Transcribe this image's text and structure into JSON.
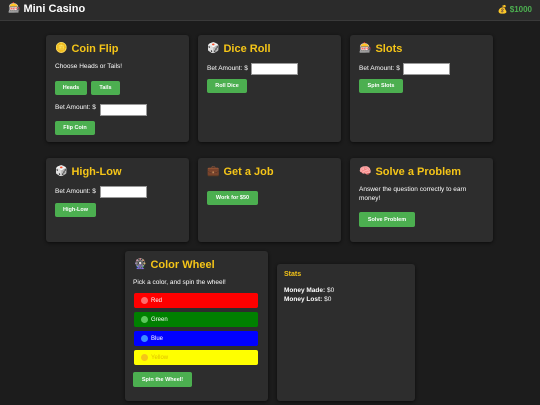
{
  "header": {
    "title": "Mini Casino",
    "balance": "$1000",
    "logo_icon": "slot-machine-icon",
    "money_icon": "money-bag-icon"
  },
  "coin_flip": {
    "title": "Coin Flip",
    "icon": "coin-icon",
    "prompt": "Choose Heads or Tails!",
    "heads_label": "Heads",
    "tails_label": "Tails",
    "bet_label": "Bet Amount: $",
    "bet_value": "",
    "action_label": "Flip Coin"
  },
  "dice_roll": {
    "title": "Dice Roll",
    "icon": "dice-icon",
    "bet_label": "Bet Amount: $",
    "bet_value": "",
    "action_label": "Roll Dice"
  },
  "slots": {
    "title": "Slots",
    "icon": "slot-machine-icon",
    "bet_label": "Bet Amount: $",
    "bet_value": "",
    "action_label": "Spin Slots"
  },
  "high_low": {
    "title": "High-Low",
    "icon": "dice-icon",
    "bet_label": "Bet Amount: $",
    "bet_value": "",
    "action_label": "High-Low"
  },
  "job": {
    "title": "Get a Job",
    "icon": "briefcase-icon",
    "action_label": "Work for $50"
  },
  "problem": {
    "title": "Solve a Problem",
    "icon": "brain-icon",
    "description": "Answer the question correctly to earn money!",
    "action_label": "Solve Problem"
  },
  "color_wheel": {
    "title": "Color Wheel",
    "icon": "wheel-icon",
    "prompt": "Pick a color, and spin the wheel!",
    "options": [
      {
        "label": "Red",
        "bg": "#ff0000",
        "dot": "#ff6b6b",
        "text": "#ffffff"
      },
      {
        "label": "Green",
        "bg": "#008000",
        "dot": "#5cc85c",
        "text": "#ffffff"
      },
      {
        "label": "Blue",
        "bg": "#0000ff",
        "dot": "#3b8cff",
        "text": "#ffffff"
      },
      {
        "label": "Yellow",
        "bg": "#ffff00",
        "dot": "#f5c518",
        "text": "#e0c000"
      }
    ],
    "action_label": "Spin the Wheel!"
  },
  "stats": {
    "title": "Stats",
    "made_label": "Money Made:",
    "made_value": "$0",
    "lost_label": "Money Lost:",
    "lost_value": "$0"
  },
  "colors": {
    "accent": "#4caf50",
    "title": "#f5c518",
    "card": "#2d2d2d",
    "background": "#1c1c1c"
  }
}
